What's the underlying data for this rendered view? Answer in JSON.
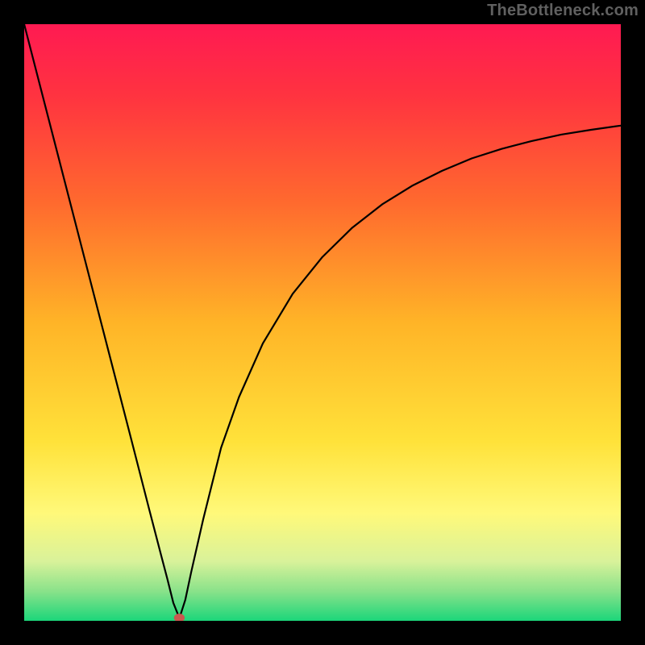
{
  "watermark": "TheBottleneck.com",
  "chart_data": {
    "type": "line",
    "title": "",
    "xlabel": "",
    "ylabel": "",
    "xlim": [
      0,
      100
    ],
    "ylim": [
      0,
      100
    ],
    "grid": false,
    "legend": false,
    "background": {
      "type": "vertical-gradient",
      "stops": [
        {
          "pos": 0.0,
          "color": "#ff1a52"
        },
        {
          "pos": 0.12,
          "color": "#ff3340"
        },
        {
          "pos": 0.3,
          "color": "#ff6a2e"
        },
        {
          "pos": 0.5,
          "color": "#ffb427"
        },
        {
          "pos": 0.7,
          "color": "#ffe23a"
        },
        {
          "pos": 0.82,
          "color": "#fff97a"
        },
        {
          "pos": 0.9,
          "color": "#d9f29a"
        },
        {
          "pos": 0.95,
          "color": "#8ae28a"
        },
        {
          "pos": 1.0,
          "color": "#1bd67a"
        }
      ]
    },
    "series": [
      {
        "name": "curve",
        "type": "line",
        "color": "#000000",
        "width": 2.2,
        "x": [
          0,
          5,
          10,
          14,
          18,
          21,
          23,
          24,
          25,
          25.8,
          26.2,
          27,
          28,
          30,
          33,
          36,
          40,
          45,
          50,
          55,
          60,
          65,
          70,
          75,
          80,
          85,
          90,
          95,
          100
        ],
        "y": [
          100,
          80.6,
          61.2,
          45.7,
          30.2,
          18.5,
          10.8,
          7.0,
          3.0,
          1.0,
          1.0,
          3.5,
          8.2,
          17.0,
          29.0,
          37.5,
          46.5,
          54.8,
          61.0,
          65.9,
          69.8,
          72.9,
          75.4,
          77.5,
          79.1,
          80.4,
          81.5,
          82.3,
          83.0
        ]
      }
    ],
    "marker": {
      "name": "minimum-point",
      "shape": "ellipse",
      "x": 26,
      "y": 0.5,
      "rx": 0.9,
      "ry": 0.7,
      "color": "#c9584f"
    }
  }
}
